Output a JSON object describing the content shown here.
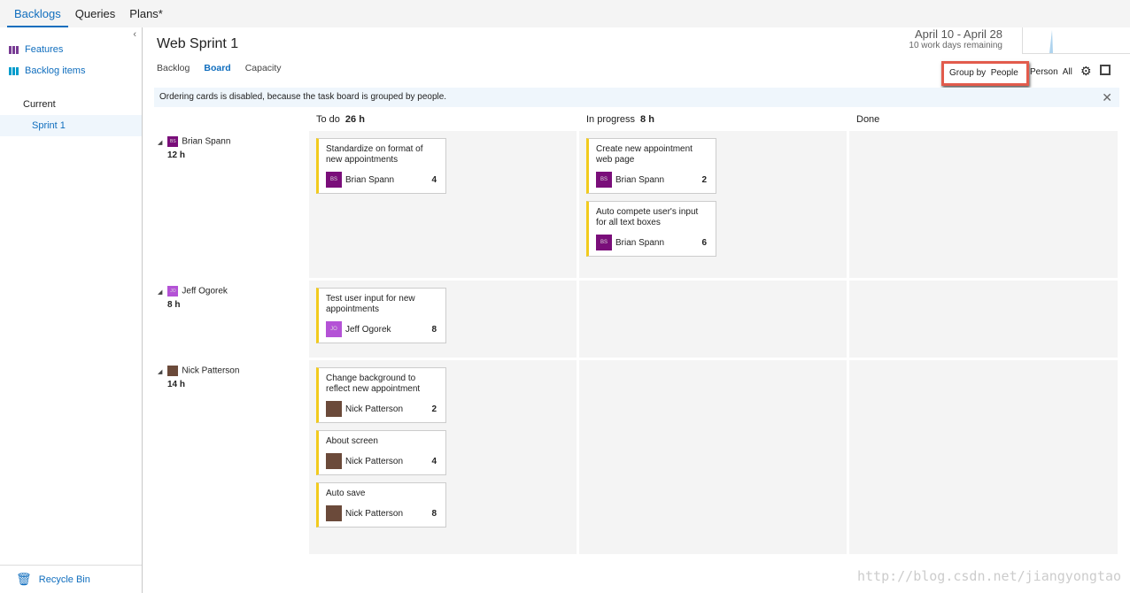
{
  "topnav": [
    "Backlogs",
    "Queries",
    "Plans*"
  ],
  "sidebar": {
    "features": "Features",
    "backlog_items": "Backlog items",
    "current": "Current",
    "sprint": "Sprint 1",
    "recycle": "Recycle Bin"
  },
  "header": {
    "title": "Web Sprint 1",
    "tabs": [
      "Backlog",
      "Board",
      "Capacity"
    ],
    "dates": "April 10 - April 28",
    "remaining": "10 work days remaining",
    "group_by_label": "Group by",
    "group_by_value": "People",
    "person_label": "Person",
    "person_value": "All"
  },
  "banner": "Ordering cards is disabled, because the task board is grouped by people.",
  "columns": [
    {
      "name": "To do",
      "hours": "26 h"
    },
    {
      "name": "In progress",
      "hours": "8 h"
    },
    {
      "name": "Done",
      "hours": ""
    }
  ],
  "colors": {
    "accent": "#106ebe",
    "card_bar": "#f2cb1d",
    "highlight": "#e25b4c"
  },
  "lanes": [
    {
      "name": "Brian Spann",
      "initials": "BS",
      "color": "#7a0e7a",
      "hours": "12 h",
      "cards": [
        [
          {
            "title": "Standardize on format of new appointments",
            "owner": "Brian Spann",
            "n": "4"
          }
        ],
        [
          {
            "title": "Create new appointment web page",
            "owner": "Brian Spann",
            "n": "2"
          },
          {
            "title": "Auto compete user's input for all text boxes",
            "owner": "Brian Spann",
            "n": "6"
          }
        ],
        []
      ]
    },
    {
      "name": "Jeff Ogorek",
      "initials": "JO",
      "color": "#b452d6",
      "hours": "8 h",
      "cards": [
        [
          {
            "title": "Test user input for new appointments",
            "owner": "Jeff Ogorek",
            "n": "8"
          }
        ],
        [],
        []
      ]
    },
    {
      "name": "Nick Patterson",
      "initials": "",
      "color": "#6b4a3a",
      "hours": "14 h",
      "cards": [
        [
          {
            "title": "Change background to reflect new appointment",
            "owner": "Nick Patterson",
            "n": "2"
          },
          {
            "title": "About screen",
            "owner": "Nick Patterson",
            "n": "4"
          },
          {
            "title": "Auto save",
            "owner": "Nick Patterson",
            "n": "8"
          }
        ],
        [],
        []
      ]
    }
  ],
  "watermark": "http://blog.csdn.net/jiangyongtao"
}
